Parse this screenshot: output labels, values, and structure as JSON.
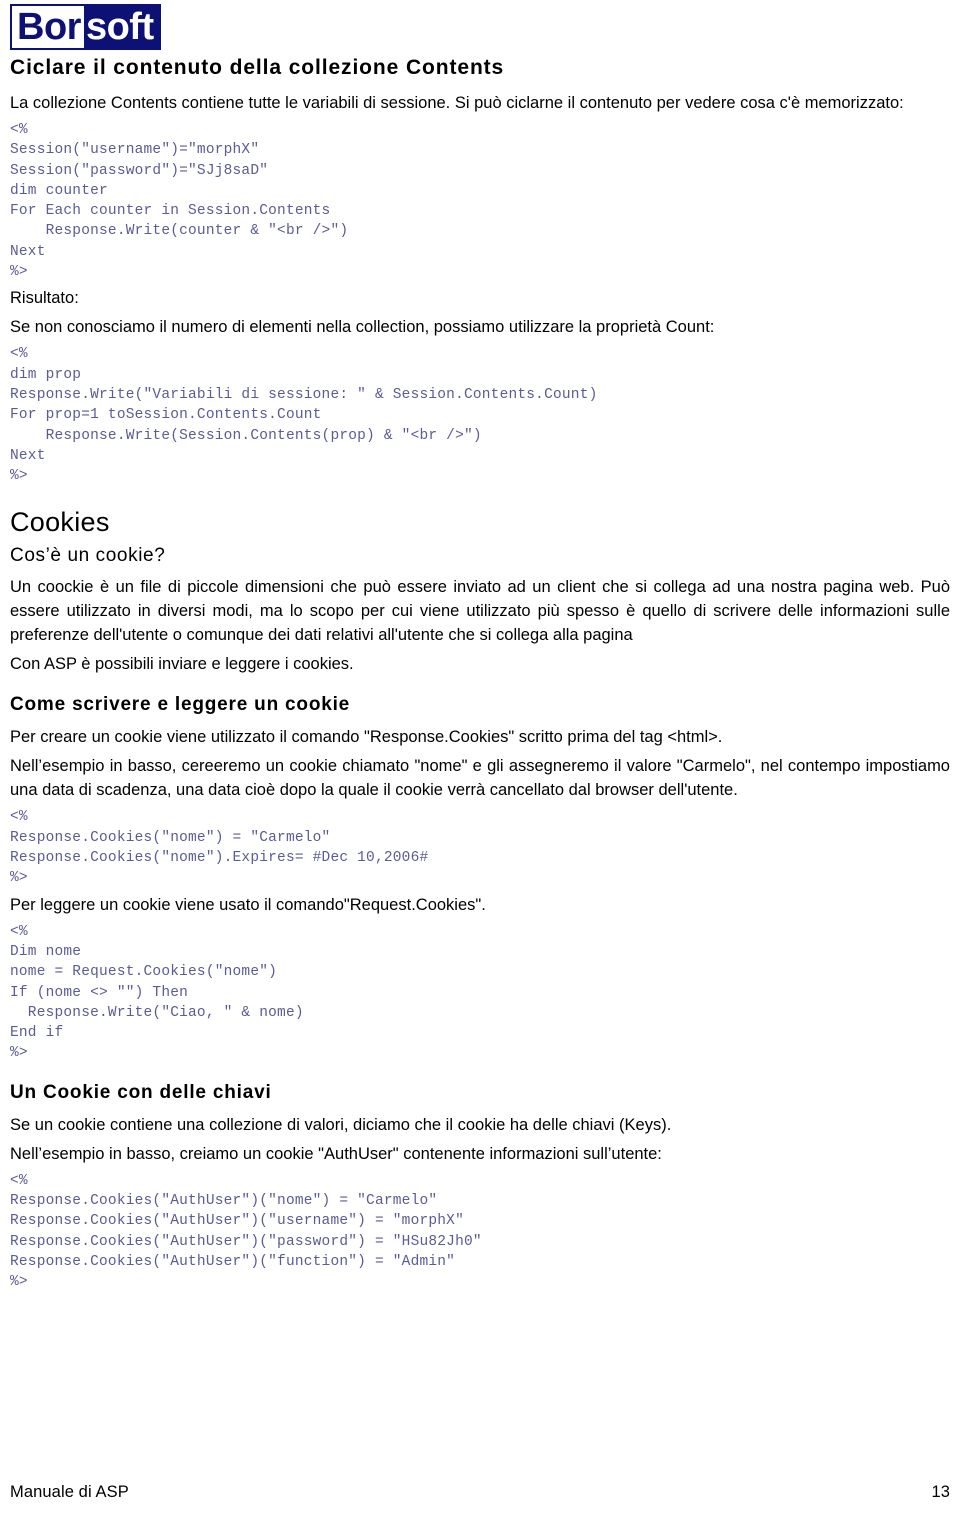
{
  "logo": {
    "part1": "Bor",
    "part2": "soft",
    "color_dark": "#0d1074",
    "color_light": "#ffffff"
  },
  "colors": {
    "code_text": "#5b5b96",
    "body_text": "#000000",
    "page_background": "#ffffff"
  },
  "sections": {
    "title": "Ciclare il contenuto della collezione Contents",
    "intro_paragraph": "La collezione Contents contiene tutte le variabili di sessione. Si può ciclarne il contenuto per vedere cosa c'è memorizzato:",
    "code_block_1": "<%\nSession(\"username\")=\"morphX\"\nSession(\"password\")=\"SJj8saD\"\ndim counter\nFor Each counter in Session.Contents\n    Response.Write(counter & \"<br />\")\nNext\n%>",
    "risultato_label": "Risultato:",
    "count_paragraph": "Se non conosciamo il numero di elementi nella collection, possiamo utilizzare la proprietà Count:",
    "code_block_2": "<%\ndim prop\nResponse.Write(\"Variabili di sessione: \" & Session.Contents.Count)\nFor prop=1 toSession.Contents.Count\n    Response.Write(Session.Contents(prop) & \"<br />\")\nNext\n%>",
    "cookies_heading": "Cookies",
    "cookies_subheading": "Cos’è un cookie?",
    "cookie_definition_paragraph": "Un coockie è un file di piccole dimensioni che può essere inviato ad un client che si collega ad una nostra pagina web. Può essere utilizzato in diversi modi, ma lo scopo per cui viene utilizzato più spesso è quello di scrivere delle informazioni sulle preferenze dell'utente o comunque dei dati relativi all'utente che si collega alla pagina",
    "cookie_asp_paragraph": "Con ASP è possibili inviare e leggere i cookies.",
    "write_read_heading": "Come scrivere e leggere un cookie",
    "write_read_paragraph_1": "Per creare un cookie viene utilizzato il comando \"Response.Cookies\" scritto prima del tag <html>.",
    "write_read_paragraph_2": "Nell’esempio in basso, cereeremo un cookie chiamato \"nome\" e gli assegneremo il valore \"Carmelo\", nel contempo impostiamo una data di scadenza, una data cioè dopo la quale il cookie verrà cancellato dal browser dell'utente.",
    "code_block_3": "<%\nResponse.Cookies(\"nome\") = \"Carmelo\"\nResponse.Cookies(\"nome\").Expires= #Dec 10,2006#\n%>",
    "read_cookie_paragraph": "Per leggere un cookie viene usato il comando\"Request.Cookies\".",
    "code_block_4": "<%\nDim nome\nnome = Request.Cookies(\"nome\")\nIf (nome <> \"\") Then\n  Response.Write(\"Ciao, \" & nome)\nEnd if\n%>",
    "keys_heading": "Un Cookie con delle chiavi",
    "keys_paragraph_1": "Se un cookie contiene una collezione di valori, diciamo che il cookie ha delle chiavi (Keys).",
    "keys_paragraph_2": "Nell’esempio in basso, creiamo un cookie \"AuthUser\" contenente informazioni sull’utente:",
    "code_block_5": "<%\nResponse.Cookies(\"AuthUser\")(\"nome\") = \"Carmelo\"\nResponse.Cookies(\"AuthUser\")(\"username\") = \"morphX\"\nResponse.Cookies(\"AuthUser\")(\"password\") = \"HSu82Jh0\"\nResponse.Cookies(\"AuthUser\")(\"function\") = \"Admin\"\n%>"
  },
  "footer": {
    "left": "Manuale di ASP",
    "right": "13"
  }
}
